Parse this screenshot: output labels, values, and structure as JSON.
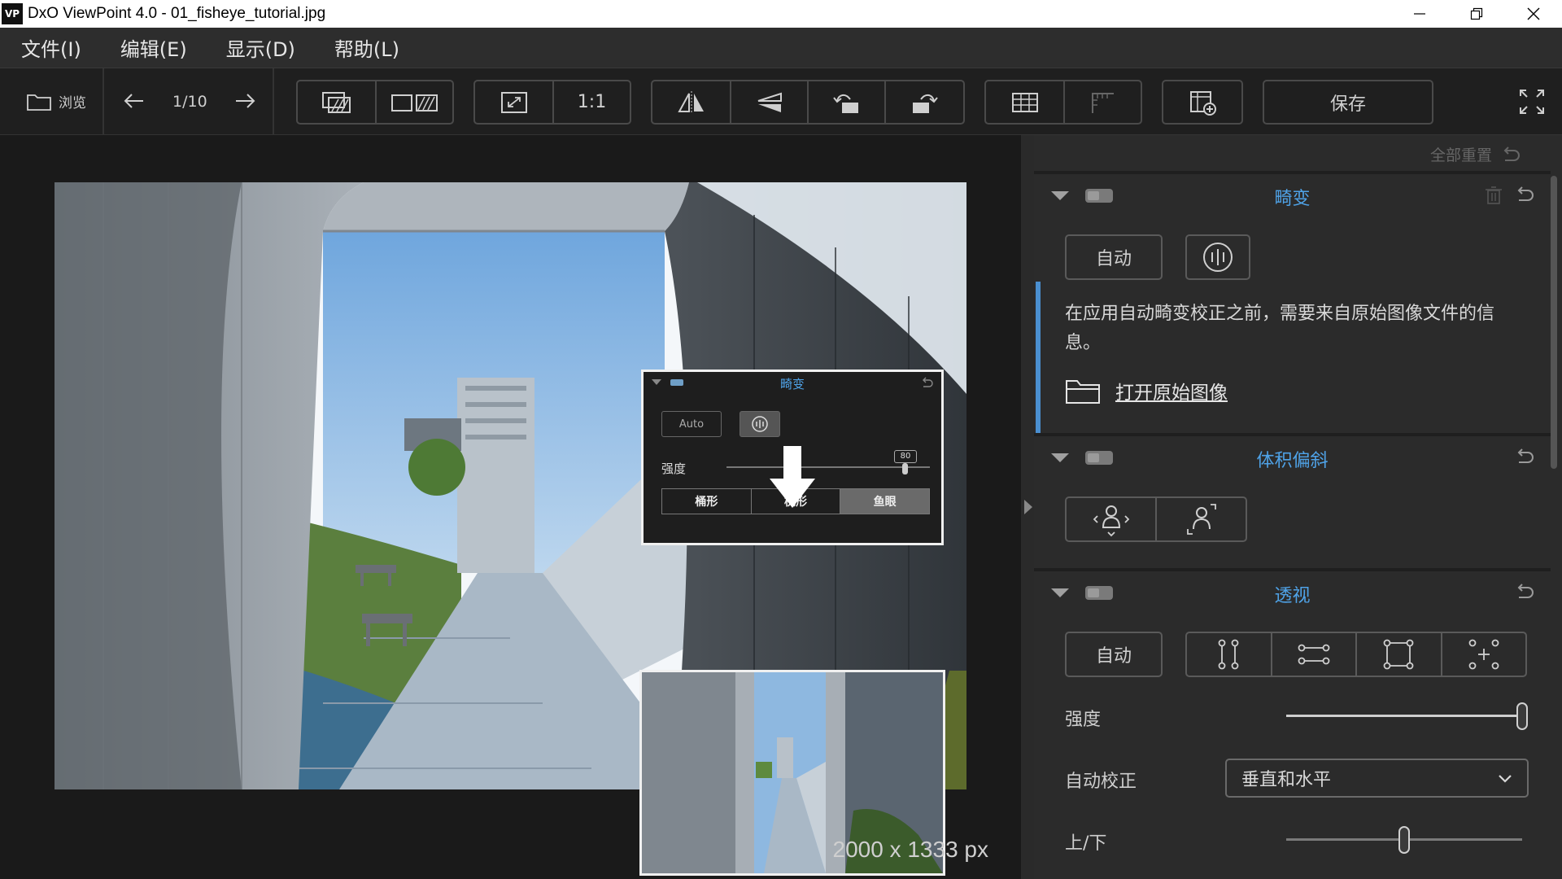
{
  "window": {
    "app_icon_text": "VP",
    "title": "DxO ViewPoint 4.0 - 01_fisheye_tutorial.jpg"
  },
  "menu": [
    {
      "label": "文件(I)"
    },
    {
      "label": "编辑(E)"
    },
    {
      "label": "显示(D)"
    },
    {
      "label": "帮助(L)"
    }
  ],
  "toolbar": {
    "browse_label": "浏览",
    "page_counter": "1/10",
    "zoom_1to1": "1:1",
    "save_label": "保存"
  },
  "canvas": {
    "image_dimensions": "2000 x 1333 px"
  },
  "inset": {
    "title": "畸变",
    "auto_label": "Auto",
    "intensity_label": "强度",
    "intensity_value": "80",
    "modes": [
      "桶形",
      "枕形",
      "鱼眼"
    ],
    "selected_mode": "鱼眼"
  },
  "panel": {
    "reset_all_label": "全部重置",
    "distortion": {
      "title": "畸变",
      "auto_label": "自动",
      "info": "在应用自动畸变校正之前，需要来自原始图像文件的信息。",
      "open_original_label": "打开原始图像"
    },
    "volume": {
      "title": "体积偏斜"
    },
    "perspective": {
      "title": "透视",
      "auto_label": "自动",
      "intensity_label": "强度",
      "intensity_value": 1.0,
      "auto_correct_label": "自动校正",
      "auto_correct_value": "垂直和水平",
      "updown_label": "上/下",
      "updown_value": 0.5
    }
  },
  "colors": {
    "accent_blue": "#4fa3e8",
    "panel_bg": "#2b2b2b",
    "canvas_bg": "#1a1a1a"
  }
}
